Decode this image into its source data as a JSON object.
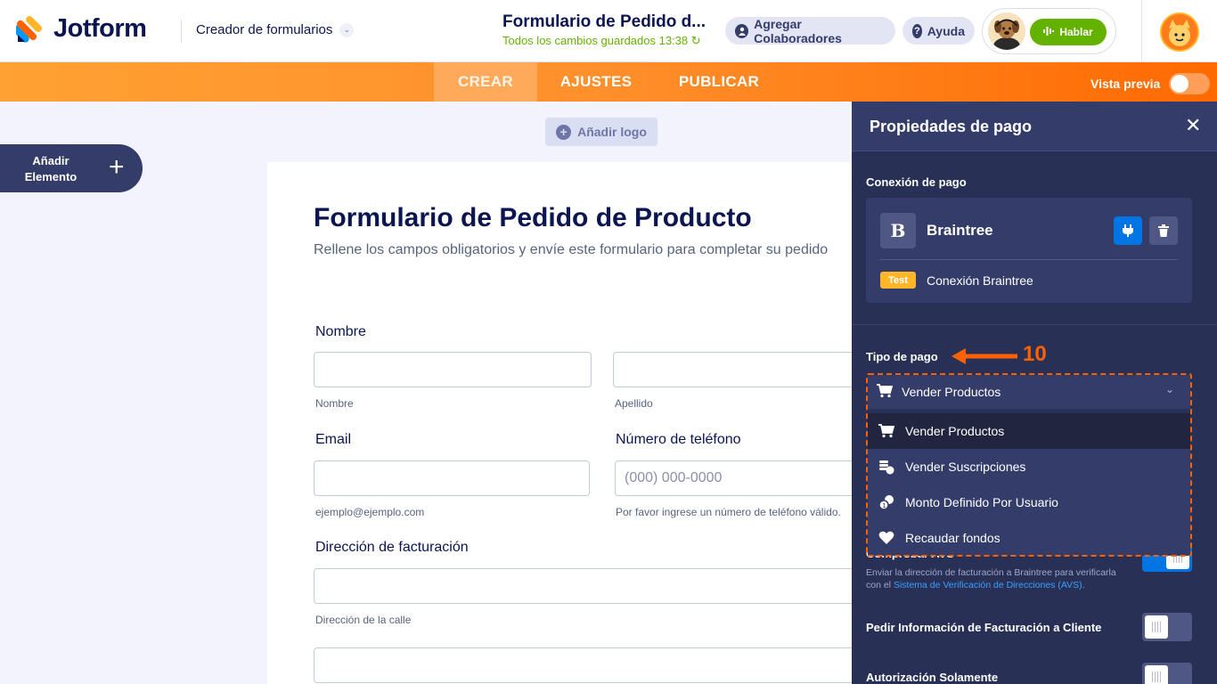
{
  "header": {
    "logo_text": "Jotform",
    "creator_label": "Creador de formularios",
    "form_title": "Formulario de Pedido d...",
    "saved_status": "Todos los cambios guardados 13:38",
    "collab_label": "Agregar Colaboradores",
    "help_label": "Ayuda",
    "talk_label": "Hablar"
  },
  "nav": {
    "tabs": [
      "CREAR",
      "AJUSTES",
      "PUBLICAR"
    ],
    "preview_label": "Vista previa"
  },
  "builder": {
    "add_element_label": "Añadir Elemento",
    "add_logo_label": "Añadir logo"
  },
  "form": {
    "title": "Formulario de Pedido de Producto",
    "subtitle": "Rellene los campos obligatorios y envíe este formulario para completar su pedido",
    "name_label": "Nombre",
    "first_name_hint": "Nombre",
    "last_name_hint": "Apellido",
    "email_label": "Email",
    "email_hint": "ejemplo@ejemplo.com",
    "phone_label": "Número de teléfono",
    "phone_placeholder": "(000) 000-0000",
    "phone_hint": "Por favor ingrese un número de teléfono válido.",
    "billing_label": "Dirección de facturación",
    "street_hint": "Dirección de la calle"
  },
  "panel": {
    "title": "Propiedades de pago",
    "connection_label": "Conexión de pago",
    "gateway_name": "Braintree",
    "gateway_initial": "B",
    "test_badge": "Test",
    "connection_name": "Conexión Braintree",
    "payment_type_label": "Tipo de pago",
    "annotation_number": "10",
    "selected_type": "Vender Productos",
    "options": [
      {
        "label": "Vender Productos",
        "icon": "cart-icon"
      },
      {
        "label": "Vender Suscripciones",
        "icon": "coins-icon"
      },
      {
        "label": "Monto Definido Por Usuario",
        "icon": "user-amount-icon"
      },
      {
        "label": "Recaudar fondos",
        "icon": "heart-icon"
      }
    ],
    "avs_label": "Comprobar AVS",
    "avs_desc": "Enviar la dirección de facturación a Braintree para verificarla con el ",
    "avs_link": "Sistema de Verificación de Direcciones (AVS)",
    "avs_desc_end": ".",
    "billing_info_label": "Pedir Información de Facturación a Cliente",
    "auth_only_label": "Autorización Solamente"
  },
  "colors": {
    "brand_orange": "#ff6100",
    "panel_bg": "#293056",
    "accent_blue": "#0075e3",
    "success_green": "#64b200"
  }
}
